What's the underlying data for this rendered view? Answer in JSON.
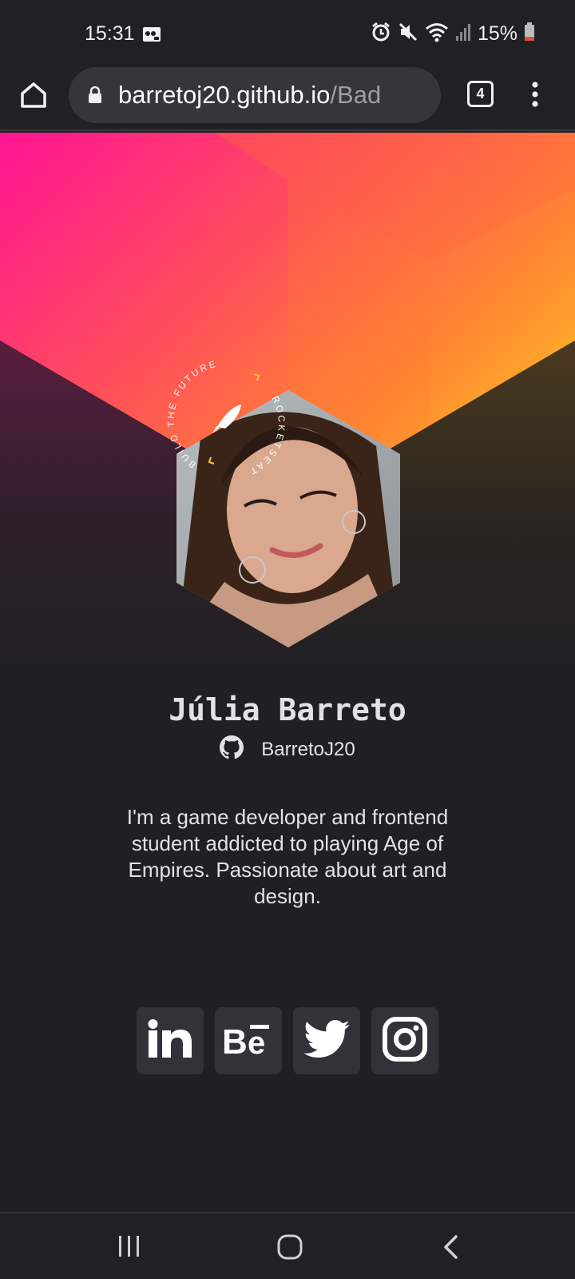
{
  "status_bar": {
    "time": "15:31",
    "battery": "15%",
    "icons": [
      "notification-icon",
      "alarm-icon",
      "mute-icon",
      "wifi-icon",
      "signal-icon",
      "battery-icon"
    ]
  },
  "browser": {
    "url_host": "barretoj20.github.io",
    "url_path": "/Bad",
    "tab_count": "4"
  },
  "profile": {
    "badge_top_text": "BUILD THE FUTURE",
    "badge_right_text": "ROCKETSEAT",
    "name": "Júlia Barreto",
    "github_user": "BarretoJ20",
    "bio": "I'm a game developer and frontend student addicted to playing Age of Empires. Passionate about art and design."
  },
  "socials": [
    "linkedin-icon",
    "behance-icon",
    "twitter-icon",
    "instagram-icon"
  ],
  "colors": {
    "background": "#202024",
    "card": "#323238",
    "text": "#e1e1e6",
    "gradient_pink": "#ff1493",
    "gradient_orange": "#ff8c2e",
    "gradient_yellow": "#ffb52a"
  }
}
